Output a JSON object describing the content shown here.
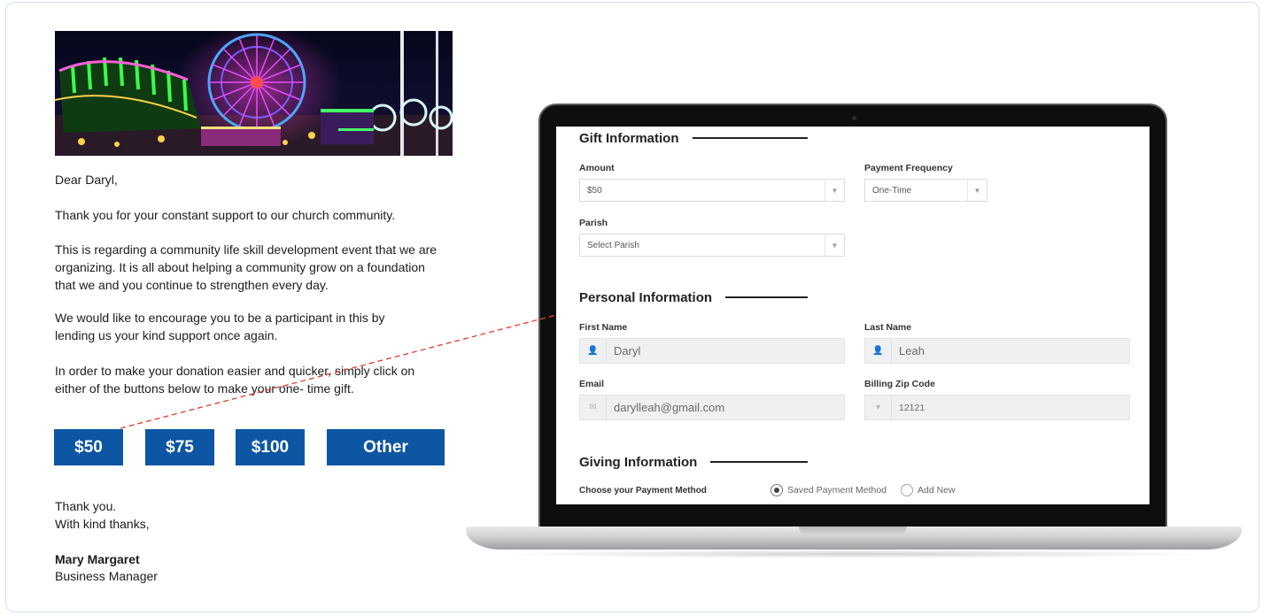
{
  "letter": {
    "greeting": "Dear Daryl,",
    "para1": "Thank you for your constant support to our church community.",
    "para2": "This is regarding a community life skill development event that we are organizing. It is all about helping a community grow on a foundation that we and you continue to strengthen every day.",
    "para3": "We would like to encourage you to be a participant in this by lending us your kind support once again.",
    "para4": "In order to make your donation easier and quicker, simply click on either of the buttons below to make your one- time gift.",
    "buttons": [
      "$50",
      "$75",
      "$100",
      "Other"
    ],
    "closing1": "Thank you.",
    "closing2": "With kind thanks,",
    "signer_name": "Mary Margaret",
    "signer_title": "Business Manager"
  },
  "form": {
    "gift_section": "Gift Information",
    "amount_label": "Amount",
    "amount_value": "$50",
    "frequency_label": "Payment Frequency",
    "frequency_value": "One-Time",
    "parish_label": "Parish",
    "parish_value": "Select Parish",
    "personal_section": "Personal Information",
    "first_name_label": "First Name",
    "first_name_value": "Daryl",
    "last_name_label": "Last Name",
    "last_name_value": "Leah",
    "email_label": "Email",
    "email_value": "darylleah@gmail.com",
    "zip_label": "Billing Zip Code",
    "zip_value": "12121",
    "giving_section": "Giving Information",
    "payment_method_label": "Choose your Payment Method",
    "payment_options": [
      "Saved Payment Method",
      "Add New"
    ],
    "payment_selected": "Saved Payment Method"
  },
  "colors": {
    "button_blue": "#0c56a3",
    "connector_red": "#e0483f",
    "card_border": "#cfe0f2"
  }
}
